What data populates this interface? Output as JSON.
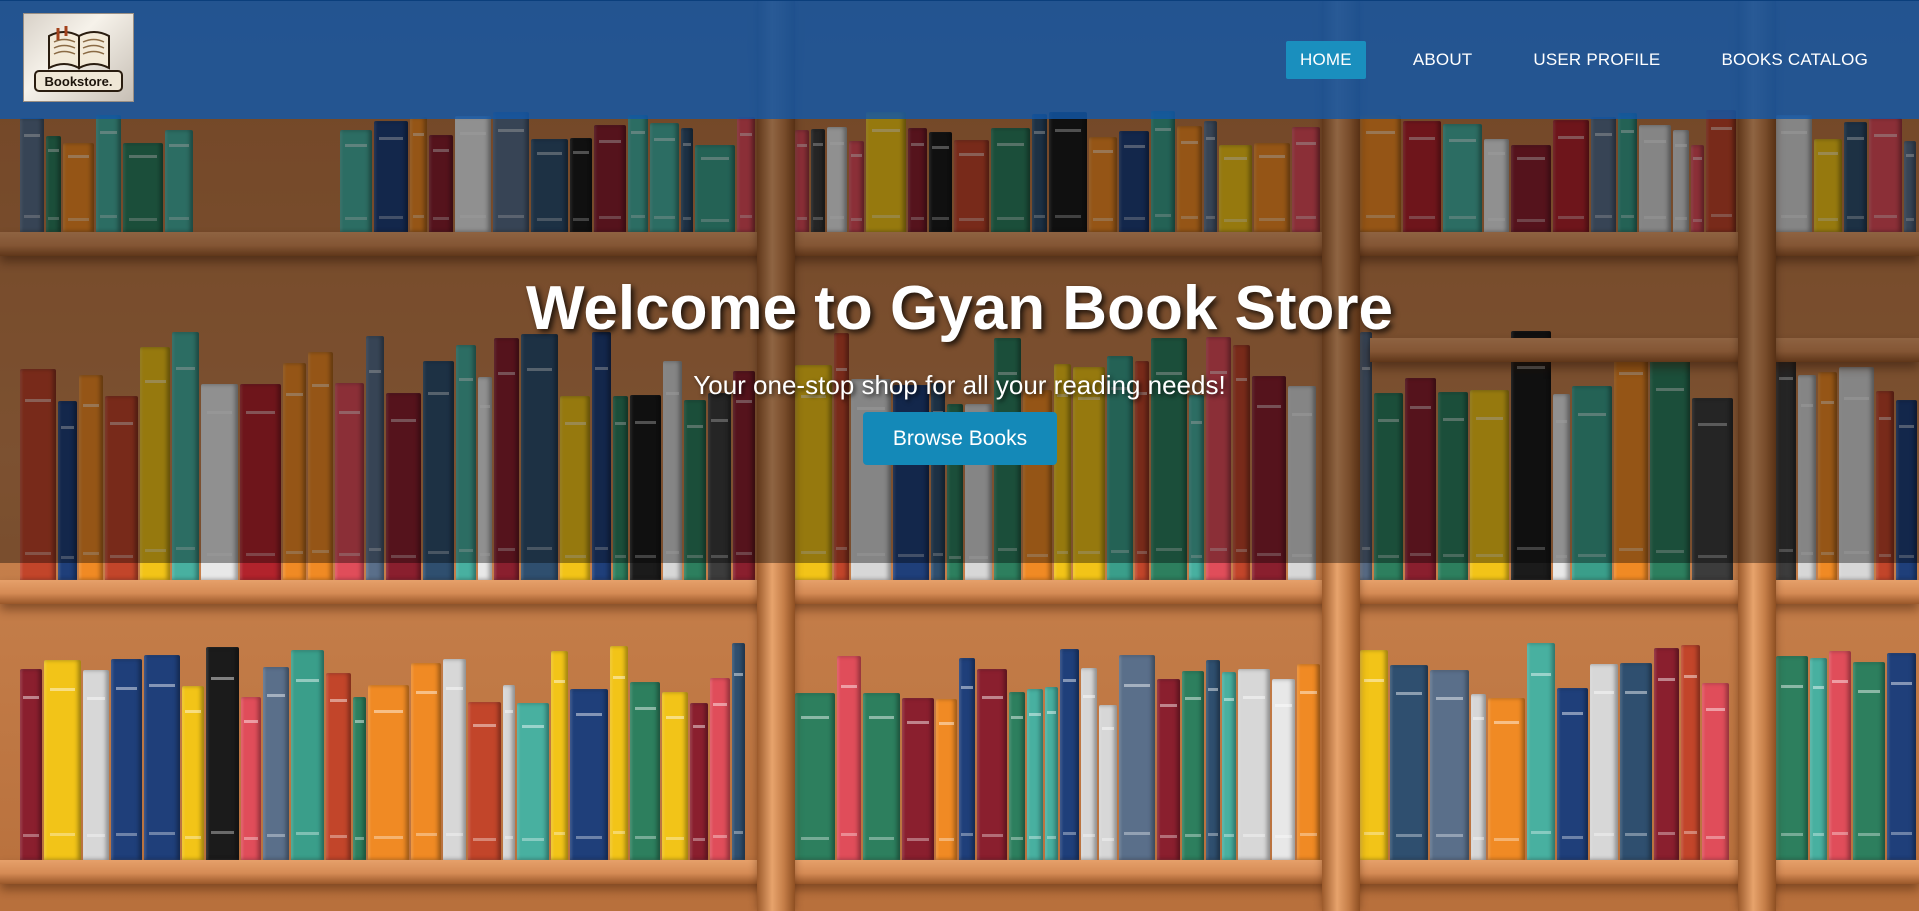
{
  "logo": {
    "alt_text": "Bookstore."
  },
  "nav": {
    "items": [
      {
        "label": "HOME",
        "active": true
      },
      {
        "label": "ABOUT",
        "active": false
      },
      {
        "label": "USER PROFILE",
        "active": false
      },
      {
        "label": "BOOKS CATALOG",
        "active": false
      }
    ]
  },
  "hero": {
    "title": "Welcome to Gyan Book Store",
    "subtitle": "Your one-stop shop for all your reading needs!",
    "cta_label": "Browse Books"
  },
  "colors": {
    "header_bg": "#1258a8",
    "active_nav": "#1a8fbe",
    "button_bg": "#1489b8",
    "text": "#ffffff"
  }
}
